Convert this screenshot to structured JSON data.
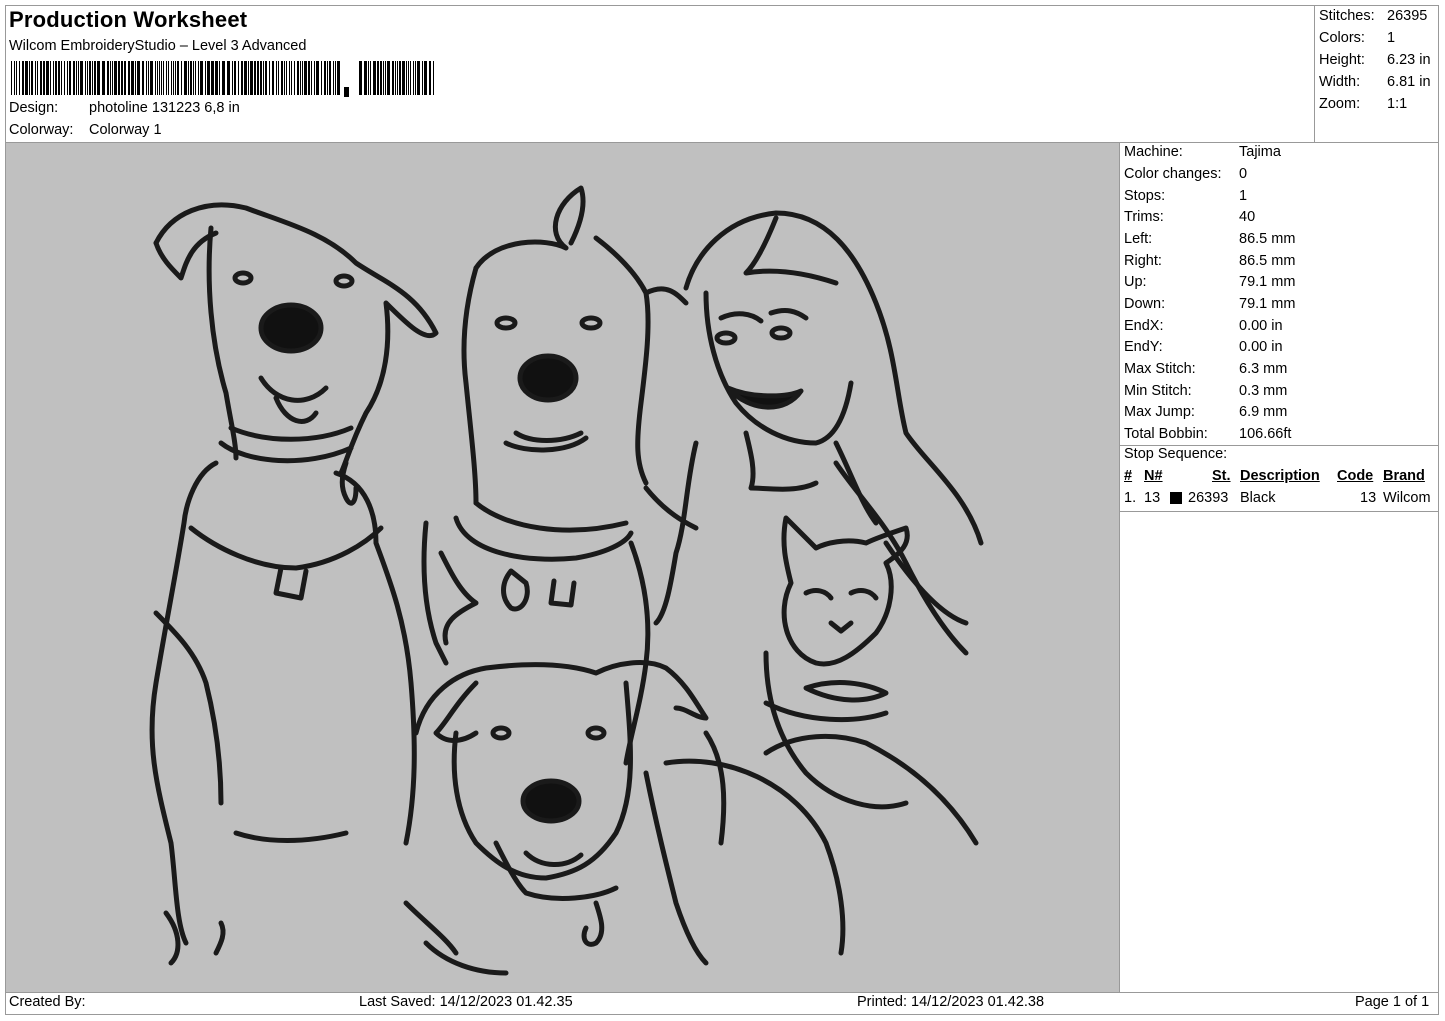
{
  "header": {
    "title": "Production Worksheet",
    "software": "Wilcom EmbroideryStudio – Level 3 Advanced",
    "design_label": "Design:",
    "design_value": "photoline 131223 6,8 in",
    "colorway_label": "Colorway:",
    "colorway_value": "Colorway 1"
  },
  "summary": {
    "stitches_label": "Stitches:",
    "stitches_value": "26395",
    "colors_label": "Colors:",
    "colors_value": "1",
    "height_label": "Height:",
    "height_value": "6.23 in",
    "width_label": "Width:",
    "width_value": "6.81 in",
    "zoom_label": "Zoom:",
    "zoom_value": "1:1"
  },
  "machine_info": {
    "machine_label": "Machine:",
    "machine_value": "Tajima",
    "color_changes_label": "Color changes:",
    "color_changes_value": "0",
    "stops_label": "Stops:",
    "stops_value": "1",
    "trims_label": "Trims:",
    "trims_value": "40",
    "left_label": "Left:",
    "left_value": "86.5 mm",
    "right_label": "Right:",
    "right_value": "86.5 mm",
    "up_label": "Up:",
    "up_value": "79.1 mm",
    "down_label": "Down:",
    "down_value": "79.1 mm",
    "endx_label": "EndX:",
    "endx_value": "0.00 in",
    "endy_label": "EndY:",
    "endy_value": "0.00 in",
    "max_stitch_label": "Max Stitch:",
    "max_stitch_value": "6.3 mm",
    "min_stitch_label": "Min Stitch:",
    "min_stitch_value": "0.3 mm",
    "max_jump_label": "Max Jump:",
    "max_jump_value": "6.9 mm",
    "total_bobbin_label": "Total Bobbin:",
    "total_bobbin_value": "106.66ft"
  },
  "stop_sequence": {
    "title": "Stop Sequence:",
    "columns": {
      "num": "#",
      "n": "N#",
      "st": "St.",
      "description": "Description",
      "code": "Code",
      "brand": "Brand"
    },
    "rows": [
      {
        "num": "1.",
        "n": "13",
        "color": "#000000",
        "st": "26393",
        "description": "Black",
        "code": "13",
        "brand": "Wilcom"
      }
    ]
  },
  "footer": {
    "created_by": "Created By:",
    "last_saved": "Last Saved: 14/12/2023 01.42.35",
    "printed": "Printed: 14/12/2023 01.42.38",
    "page": "Page 1 of 1"
  },
  "colors": {
    "canvas_bg": "#c0c0c0",
    "thread": "#000000"
  }
}
